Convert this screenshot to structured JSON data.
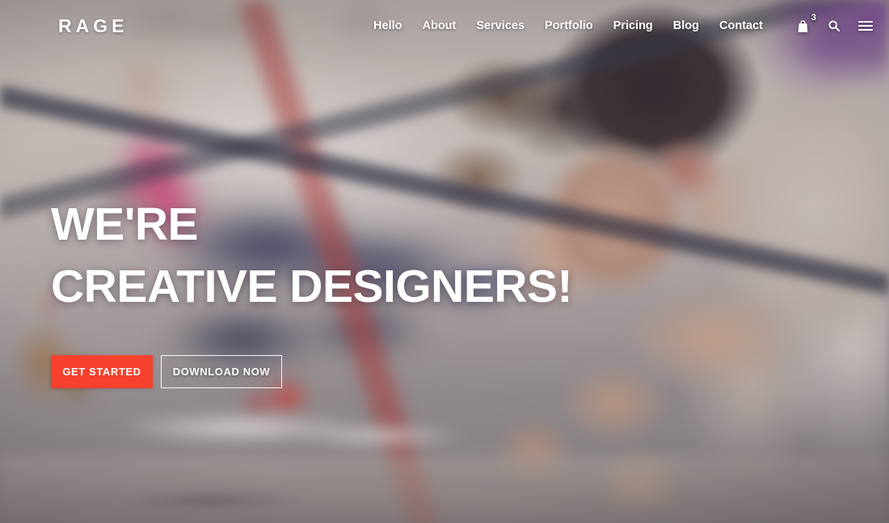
{
  "header": {
    "brand": "RAGE",
    "nav_items": [
      {
        "label": "Hello"
      },
      {
        "label": "About"
      },
      {
        "label": "Services"
      },
      {
        "label": "Portfolio"
      },
      {
        "label": "Pricing"
      },
      {
        "label": "Blog"
      },
      {
        "label": "Contact"
      }
    ],
    "icons": {
      "cart_name": "shopping-bag-icon",
      "cart_badge_count": "3",
      "search_name": "search-icon",
      "menu_name": "hamburger-menu-icon"
    }
  },
  "hero": {
    "headline_line1": "WE'RE",
    "headline_line2": "CREATIVE DESIGNERS!",
    "primary_button": "GET STARTED",
    "secondary_button": "DOWNLOAD NOW"
  },
  "colors": {
    "accent_red": "#f5412e",
    "text_white": "#ffffff",
    "purple_glow": "#8a5fa8",
    "photo_pink": "#d62468",
    "photo_navy": "#22264c"
  }
}
